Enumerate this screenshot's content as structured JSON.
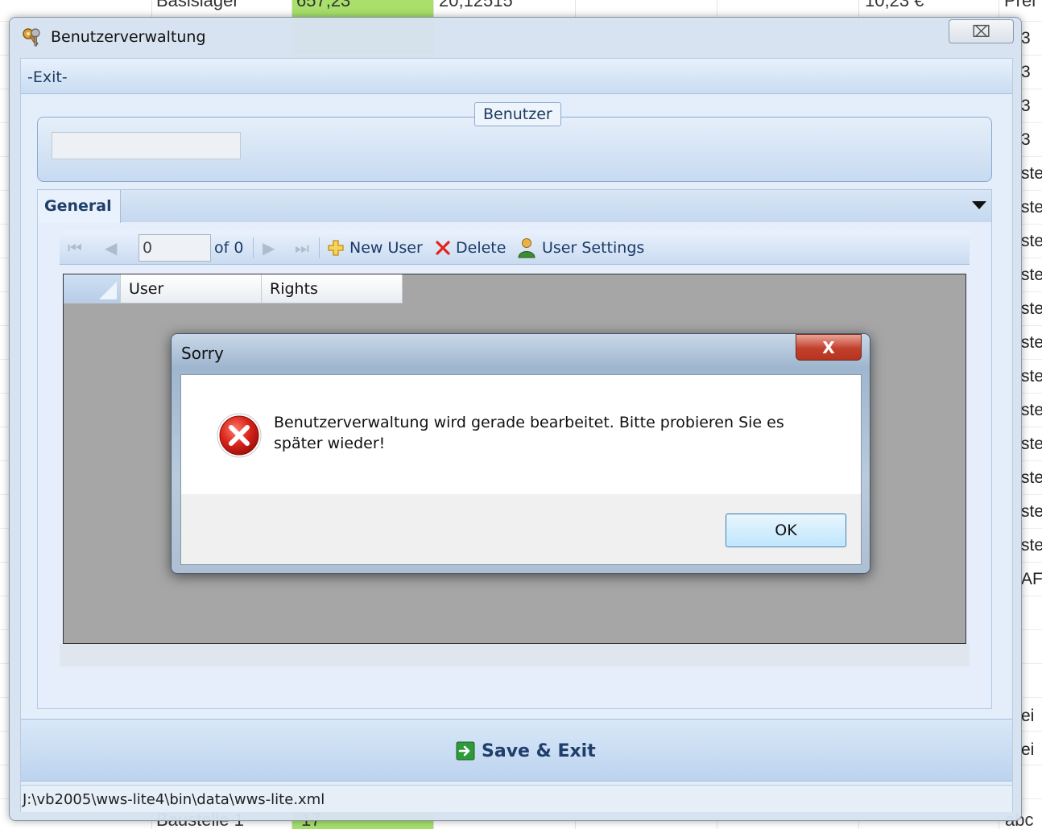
{
  "background": {
    "top_cells": [
      "Basislager",
      "657,23",
      "20,12515",
      "10,23 €",
      "Prei"
    ],
    "bottom_cells": [
      "Baustelle 1",
      "17",
      "abc"
    ],
    "right_cells": [
      "3",
      "3",
      "3",
      "3",
      "ste",
      "ste",
      "ste",
      "ste",
      "ste",
      "ste",
      "ste",
      "ste",
      "ste",
      "ste",
      "ste",
      "ste",
      "AF",
      "ei",
      "ei"
    ]
  },
  "main_window": {
    "title": "Benutzerverwaltung",
    "icon": "keys-icon",
    "close_glyph": "⌧",
    "menu": {
      "exit_label": "-Exit-"
    },
    "benutzer_group": {
      "legend": "Benutzer",
      "input_value": ""
    },
    "tabs": [
      {
        "label": "General",
        "active": true
      }
    ],
    "toolbar": {
      "position_value": "0",
      "of_label": "of 0",
      "new_user_label": "New User",
      "delete_label": "Delete",
      "user_settings_label": "User Settings"
    },
    "grid": {
      "columns": [
        "User",
        "Rights"
      ],
      "rows": []
    },
    "save_exit_label": "Save & Exit",
    "status_path": "J:\\vb2005\\wws-lite4\\bin\\data\\wws-lite.xml"
  },
  "dialog": {
    "title": "Sorry",
    "close_glyph": "X",
    "message": "Benutzerverwaltung wird gerade bearbeitet. Bitte probieren Sie es später wieder!",
    "ok_label": "OK",
    "icon": "error-icon"
  },
  "colors": {
    "accent_blue": "#1f3f6b",
    "close_red": "#c2402b",
    "bg_green_column": "#a8e06b"
  }
}
